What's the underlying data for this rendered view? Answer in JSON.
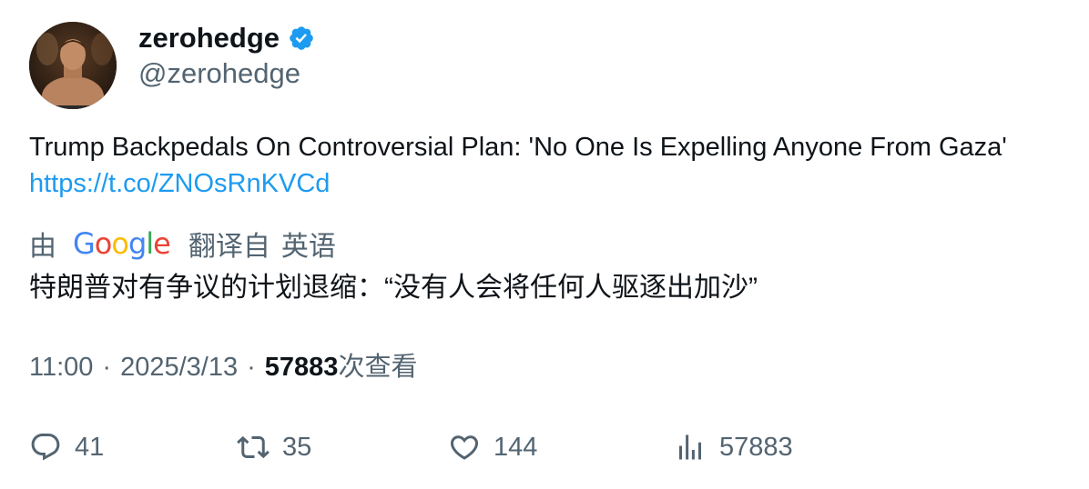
{
  "user": {
    "display_name": "zerohedge",
    "handle": "@zerohedge",
    "verified_icon": "verified-badge-icon"
  },
  "tweet": {
    "text": "Trump Backpedals On Controversial Plan: 'No One Is Expelling Anyone From Gaza'",
    "link": "https://t.co/ZNOsRnKVCd"
  },
  "translation": {
    "by_label": "由",
    "provider_letters": [
      "G",
      "o",
      "o",
      "g",
      "l",
      "e"
    ],
    "provider_colors": [
      "#4285F4",
      "#EA4335",
      "#FBBC05",
      "#4285F4",
      "#34A853",
      "#EA4335"
    ],
    "translated_from_label": "翻译自",
    "source_language": "英语",
    "text": "特朗普对有争议的计划退缩：“没有人会将任何人驱逐出加沙”"
  },
  "meta": {
    "time": "11:00",
    "separator": "·",
    "date": "2025/3/13",
    "views_count": "57883",
    "views_label": "次查看"
  },
  "actions": {
    "replies": "41",
    "retweets": "35",
    "likes": "144",
    "views": "57883"
  },
  "colors": {
    "link": "#1d9bf0",
    "verified": "#1d9bf0",
    "secondary_text": "#536471",
    "primary_text": "#0f1419"
  }
}
